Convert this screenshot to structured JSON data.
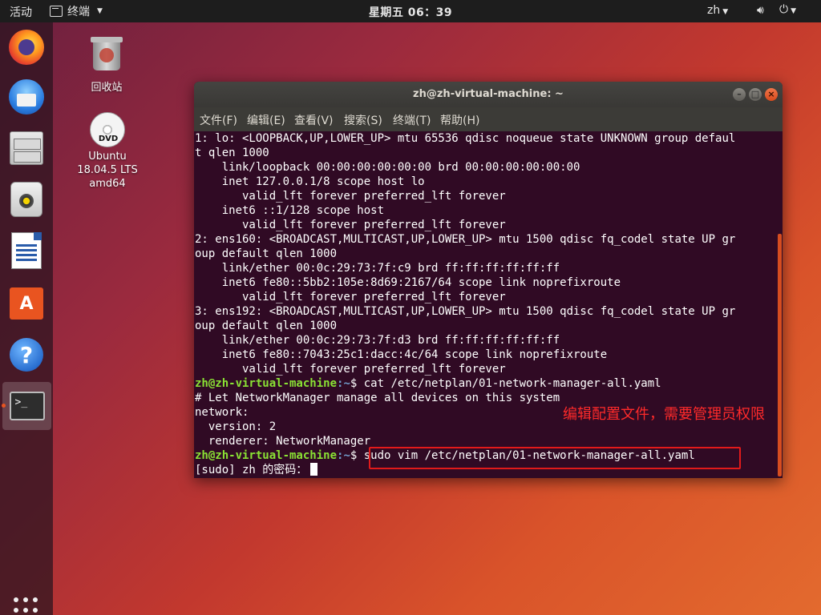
{
  "topbar": {
    "activities": "活动",
    "app_name": "终端",
    "clock": "星期五 06：39",
    "lang": "zh"
  },
  "desktop": {
    "trash_label": "回收站",
    "dvd_label_1": "Ubuntu",
    "dvd_label_2": "18.04.5 LTS",
    "dvd_label_3": "amd64",
    "dvd_text": "DVD"
  },
  "window": {
    "title": "zh@zh-virtual-machine: ~",
    "menu": [
      "文件(F)",
      "编辑(E)",
      "查看(V)",
      "搜索(S)",
      "终端(T)",
      "帮助(H)"
    ]
  },
  "terminal": {
    "lines": [
      "1: lo: <LOOPBACK,UP,LOWER_UP> mtu 65536 qdisc noqueue state UNKNOWN group defaul",
      "t qlen 1000",
      "    link/loopback 00:00:00:00:00:00 brd 00:00:00:00:00:00",
      "    inet 127.0.0.1/8 scope host lo",
      "       valid_lft forever preferred_lft forever",
      "    inet6 ::1/128 scope host",
      "       valid_lft forever preferred_lft forever",
      "2: ens160: <BROADCAST,MULTICAST,UP,LOWER_UP> mtu 1500 qdisc fq_codel state UP gr",
      "oup default qlen 1000",
      "    link/ether 00:0c:29:73:7f:c9 brd ff:ff:ff:ff:ff:ff",
      "    inet6 fe80::5bb2:105e:8d69:2167/64 scope link noprefixroute",
      "       valid_lft forever preferred_lft forever",
      "3: ens192: <BROADCAST,MULTICAST,UP,LOWER_UP> mtu 1500 qdisc fq_codel state UP gr",
      "oup default qlen 1000",
      "    link/ether 00:0c:29:73:7f:d3 brd ff:ff:ff:ff:ff:ff",
      "    inet6 fe80::7043:25c1:dacc:4c/64 scope link noprefixroute",
      "       valid_lft forever preferred_lft forever"
    ],
    "prompt_user": "zh@zh-virtual-machine",
    "prompt_path": ":~",
    "prompt_sign": "$ ",
    "cmd1": "cat /etc/netplan/01-network-manager-all.yaml",
    "output2": [
      "# Let NetworkManager manage all devices on this system",
      "network:",
      "  version: 2",
      "  renderer: NetworkManager"
    ],
    "cmd2": "sudo vim /etc/netplan/01-network-manager-all.yaml",
    "sudo_prompt": "[sudo] zh 的密码："
  },
  "annotation": {
    "text": "编辑配置文件，需要管理员权限",
    "color": "#e21a1a"
  },
  "colors": {
    "terminal_bg": "#300a24",
    "prompt_user": "#8ae234",
    "prompt_path": "#729fcf",
    "accent": "#e95420"
  }
}
